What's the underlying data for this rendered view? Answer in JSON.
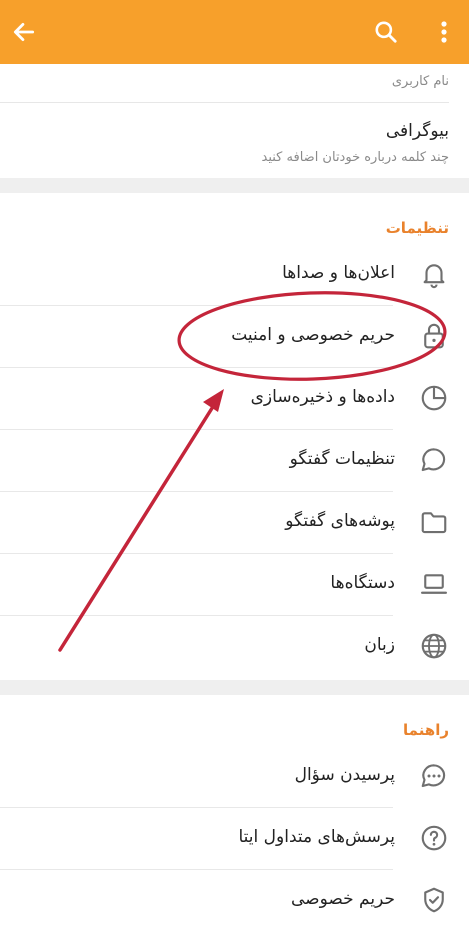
{
  "appbar": {
    "back_icon": "arrow-left-icon",
    "search_icon": "search-icon",
    "more_icon": "more-vertical-icon",
    "background": "#f7a02b"
  },
  "profile": {
    "username_sub": "نام کاربری",
    "bio_title": "بیوگرافی",
    "bio_sub": "چند کلمه درباره خودتان اضافه کنید"
  },
  "settings": {
    "heading": "تنظیمات",
    "items": [
      {
        "label": "اعلان‌ها و صداها",
        "icon": "bell-icon"
      },
      {
        "label": "حریم خصوصی و امنیت",
        "icon": "lock-icon"
      },
      {
        "label": "داده‌ها و ذخیره‌سازی",
        "icon": "pie-chart-icon"
      },
      {
        "label": "تنظیمات گفتگو",
        "icon": "chat-bubble-icon"
      },
      {
        "label": "پوشه‌های گفتگو",
        "icon": "folder-icon"
      },
      {
        "label": "دستگاه‌ها",
        "icon": "laptop-icon"
      },
      {
        "label": "زبان",
        "icon": "globe-icon"
      }
    ]
  },
  "help": {
    "heading": "راهنما",
    "items": [
      {
        "label": "پرسیدن سؤال",
        "icon": "chat-dots-icon"
      },
      {
        "label": "پرسش‌های متداول ایتا",
        "icon": "question-circle-icon"
      },
      {
        "label": "حریم خصوصی",
        "icon": "shield-check-icon"
      }
    ]
  },
  "colors": {
    "accent": "#e9822c",
    "annotation": "#c4253a"
  }
}
